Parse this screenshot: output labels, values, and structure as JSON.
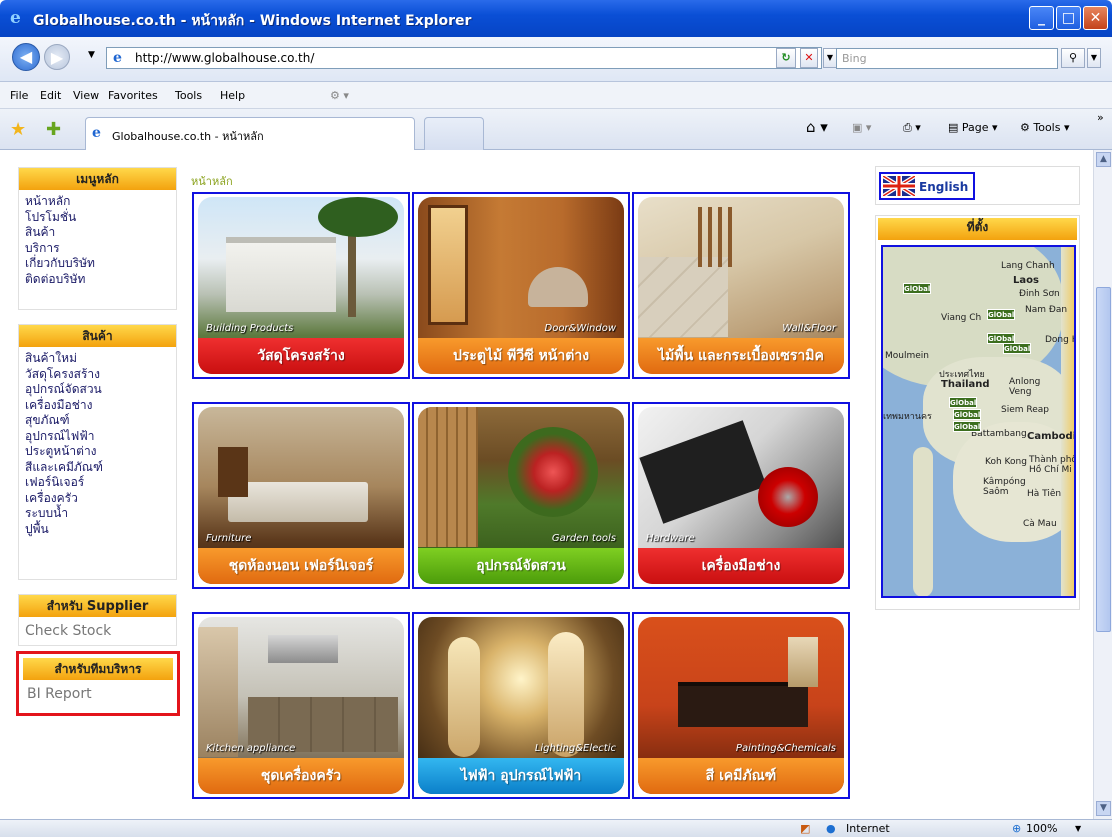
{
  "window": {
    "title": "Globalhouse.co.th - หน้าหลัก - Windows Internet Explorer",
    "minimize": "_",
    "maximize": "□",
    "close": "✕"
  },
  "toolbar": {
    "back": "◀",
    "forward": "▶",
    "url": "http://www.globalhouse.co.th/",
    "search_placeholder": "Bing"
  },
  "menu": [
    "File",
    "Edit",
    "View",
    "Favorites",
    "Tools",
    "Help"
  ],
  "tab": {
    "label": "Globalhouse.co.th - หน้าหลัก",
    "commands": [
      "Page",
      "Tools"
    ]
  },
  "left": {
    "main_menu_title": "เมนูหลัก",
    "main_menu": [
      "หน้าหลัก",
      "โปรโมชั่น",
      "สินค้า",
      "บริการ",
      "เกี่ยวกับบริษัท",
      "ติดต่อบริษัท"
    ],
    "products_title": "สินค้า",
    "products": [
      "สินค้าใหม่",
      "วัสดุโครงสร้าง",
      "อุปกรณ์จัดสวน",
      "เครื่องมือช่าง",
      "สุขภัณฑ์",
      "อุปกรณ์ไฟฟ้า",
      "ประตูหน้าต่าง",
      "สีและเคมีภัณฑ์",
      "เฟอร์นิเจอร์",
      "เครื่องครัว",
      "ระบบน้ำ",
      "ปูพื้น"
    ],
    "supplier_title_prefix": "สำหรับ",
    "supplier_title_strong": "Supplier",
    "supplier_link": "Check Stock",
    "exec_title": "สำหรับทีมบริหาร",
    "exec_link": "BI Report"
  },
  "breadcrumb": "หน้าหลัก",
  "tiles": [
    {
      "label": "วัสดุโครงสร้าง",
      "sub": "Building Products",
      "band": "red"
    },
    {
      "label": "ประตูไม้ พีวีซี หน้าต่าง",
      "sub": "Door&Window",
      "band": "orange"
    },
    {
      "label": "ไม้พื้น และกระเบื้องเซรามิค",
      "sub": "Wall&Floor",
      "band": "orange"
    },
    {
      "label": "ชุดห้องนอน เฟอร์นิเจอร์",
      "sub": "Furniture",
      "band": "orange"
    },
    {
      "label": "อุปกรณ์จัดสวน",
      "sub": "Garden tools",
      "band": "green"
    },
    {
      "label": "เครื่องมือช่าง",
      "sub": "Hardware",
      "band": "red"
    },
    {
      "label": "ชุดเครื่องครัว",
      "sub": "Kitchen appliance",
      "band": "orange"
    },
    {
      "label": "ไฟฟ้า อุปกรณ์ไฟฟ้า",
      "sub": "Lighting&Electic",
      "band": "blue"
    },
    {
      "label": "สี เคมีภัณฑ์",
      "sub": "Painting&Chemicals",
      "band": "orange"
    }
  ],
  "right": {
    "english": "English",
    "location_title": "ที่ตั้ง",
    "map_labels": [
      "Lang Chanh",
      "Laos",
      "Đinh Sơn",
      "Viang Ch",
      "Nam Đan",
      "Dong H",
      "Moulmein",
      "ประเทศไทย",
      "Thailand",
      "Anlong Veng",
      "Siem Reap",
      "Battambang",
      "Cambodia",
      "Koh Kong",
      "Thành phố Hồ Chí Mi",
      "Kâmpóng Saôm",
      "Hà Tiên",
      "Cà Mau",
      "เทพมหานคร"
    ]
  },
  "status": {
    "zone": "Internet",
    "zoom": "100%"
  }
}
